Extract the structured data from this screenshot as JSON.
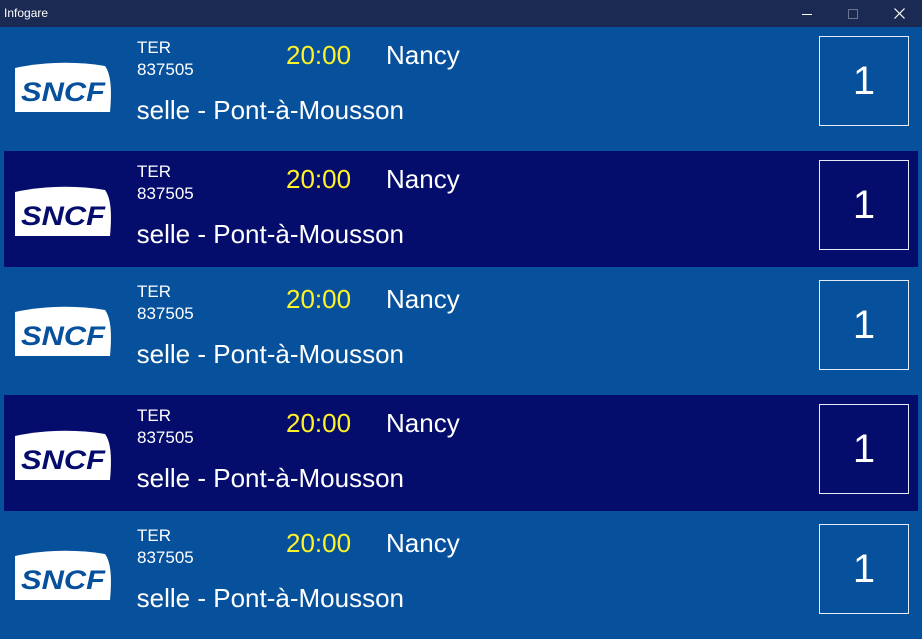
{
  "window": {
    "title": "Infogare",
    "controls": [
      "minimize-icon",
      "maximize-icon",
      "close-icon"
    ]
  },
  "colors": {
    "row_light": "#07509b",
    "row_dark": "#040c6c",
    "time": "#fff227",
    "text": "#ffffff",
    "titlebar": "#1b2a52"
  },
  "departures": [
    {
      "logo": "SNCF",
      "train_type": "TER",
      "train_number": "837505",
      "time": "20:00",
      "destination": "Nancy",
      "stops": "selle - Pont-à-Mousson",
      "platform": "1"
    },
    {
      "logo": "SNCF",
      "train_type": "TER",
      "train_number": "837505",
      "time": "20:00",
      "destination": "Nancy",
      "stops": "selle - Pont-à-Mousson",
      "platform": "1"
    },
    {
      "logo": "SNCF",
      "train_type": "TER",
      "train_number": "837505",
      "time": "20:00",
      "destination": "Nancy",
      "stops": "selle - Pont-à-Mousson",
      "platform": "1"
    },
    {
      "logo": "SNCF",
      "train_type": "TER",
      "train_number": "837505",
      "time": "20:00",
      "destination": "Nancy",
      "stops": "selle - Pont-à-Mousson",
      "platform": "1"
    },
    {
      "logo": "SNCF",
      "train_type": "TER",
      "train_number": "837505",
      "time": "20:00",
      "destination": "Nancy",
      "stops": "selle - Pont-à-Mousson",
      "platform": "1"
    }
  ]
}
